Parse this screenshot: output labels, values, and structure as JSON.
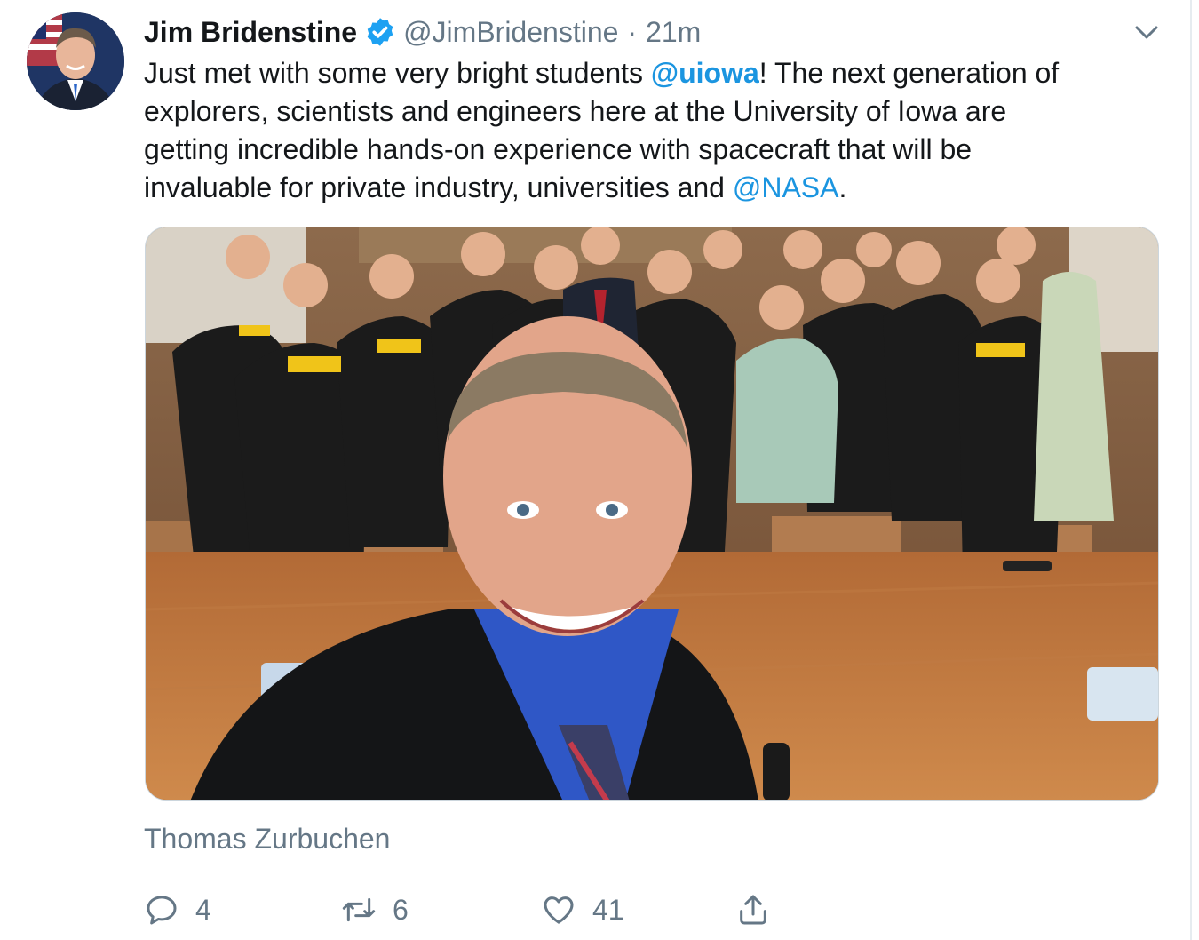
{
  "tweet": {
    "author_name": "Jim Bridenstine",
    "verified": true,
    "handle": "@JimBridenstine",
    "separator": "·",
    "timestamp": "21m",
    "text": {
      "line1_before": "Just met with some very bright students ",
      "mention1": "@uiowa",
      "line1_after": "! The next generation of",
      "line2": "explorers, scientists and engineers here at the University of Iowa are",
      "line3": "getting incredible hands-on experience with spacecraft that will be",
      "line4_before": "invaluable for private industry, universities and ",
      "mention2": "@NASA",
      "line4_after": "."
    },
    "tagged_user": "Thomas Zurbuchen",
    "actions": {
      "reply_count": "4",
      "retweet_count": "6",
      "like_count": "41"
    }
  },
  "icons": {
    "verified": "verified-badge-icon",
    "caret": "chevron-down-icon",
    "reply": "reply-icon",
    "retweet": "retweet-icon",
    "like": "heart-icon",
    "share": "share-icon"
  },
  "colors": {
    "link": "#1b95e0",
    "secondary_text": "#657786",
    "primary_text": "#14171a",
    "divider": "#e6ecf0"
  }
}
